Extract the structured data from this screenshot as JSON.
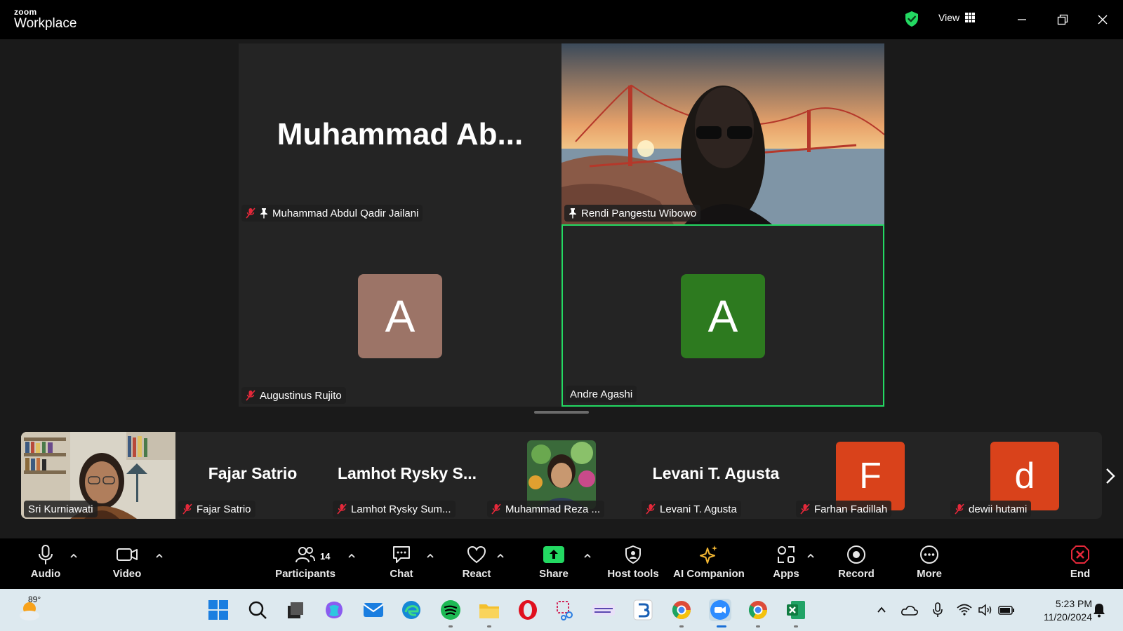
{
  "app": {
    "brand_top": "zoom",
    "brand_bottom": "Workplace",
    "view_label": "View"
  },
  "tiles": [
    {
      "display": "Muhammad  Ab...",
      "label": "Muhammad Abdul Qadir Jailani",
      "muted": true,
      "pinned": true
    },
    {
      "display": "",
      "label": "Rendi Pangestu Wibowo",
      "muted": false,
      "pinned": true
    },
    {
      "avatar": "A",
      "label": "Augustinus Rujito",
      "muted": true,
      "color": "#9c7467"
    },
    {
      "avatar": "A",
      "label": "Andre Agashi",
      "muted": false,
      "color": "#2d7a1f",
      "active": true
    }
  ],
  "filmstrip": [
    {
      "label": "Sri Kurniawati",
      "type": "video"
    },
    {
      "display": "Fajar Satrio",
      "label": "Fajar Satrio",
      "muted": true
    },
    {
      "display": "Lamhot  Rysky  S...",
      "label": "Lamhot Rysky Sum...",
      "muted": true
    },
    {
      "label": "Muhammad Reza ...",
      "type": "photo",
      "muted": true
    },
    {
      "display": "Levani T. Agusta",
      "label": "Levani T. Agusta",
      "muted": true
    },
    {
      "avatar": "F",
      "label": "Farhan Fadillah",
      "muted": true,
      "color": "#d9421b"
    },
    {
      "avatar": "d",
      "label": "dewii hutami",
      "muted": true,
      "color": "#d9421b"
    }
  ],
  "toolbar": {
    "audio": "Audio",
    "video": "Video",
    "participants": "Participants",
    "participants_count": "14",
    "chat": "Chat",
    "react": "React",
    "share": "Share",
    "host_tools": "Host tools",
    "ai_companion": "AI Companion",
    "apps": "Apps",
    "record": "Record",
    "more": "More",
    "end": "End"
  },
  "taskbar": {
    "weather_temp": "89°",
    "time": "5:23 PM",
    "date": "11/20/2024"
  },
  "colors": {
    "active_border": "#23d962",
    "share_green": "#23d962",
    "end_red": "#e5283a",
    "muted_red": "#e5283a"
  }
}
